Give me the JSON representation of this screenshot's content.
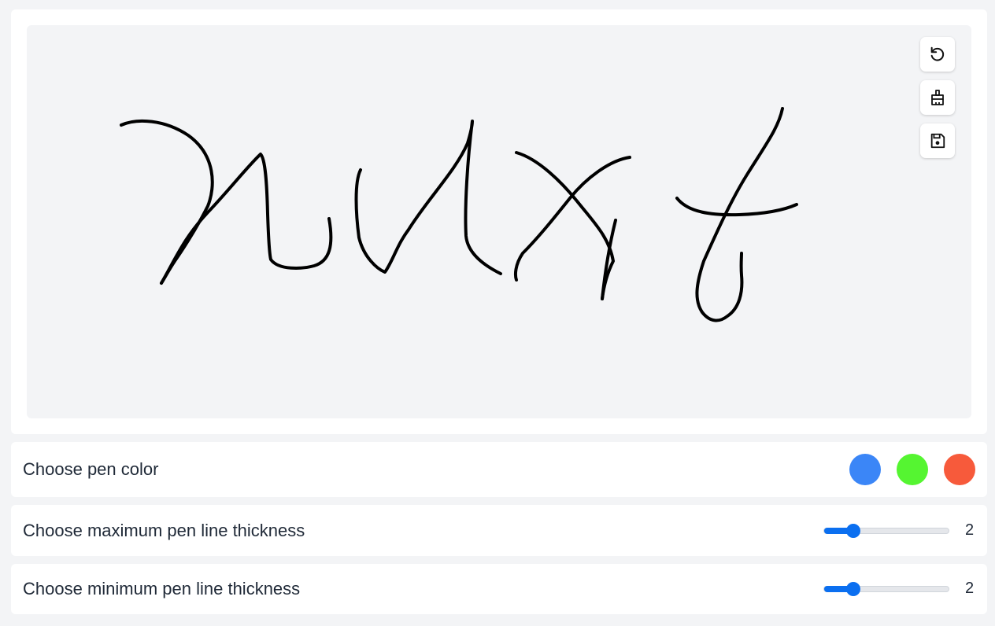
{
  "toolbar": {
    "undo_icon": "undo-icon",
    "clear_icon": "eraser-icon",
    "save_icon": "floppy-disk-icon"
  },
  "color_picker": {
    "label": "Choose pen color",
    "colors": [
      "#3b86f7",
      "#55f531",
      "#f75a3b"
    ]
  },
  "max_thickness": {
    "label": "Choose maximum pen line thickness",
    "value": "2",
    "fraction": 0.23
  },
  "min_thickness": {
    "label": "Choose minimum pen line thickness",
    "value": "2",
    "fraction": 0.23
  },
  "pen_color": "#000000"
}
